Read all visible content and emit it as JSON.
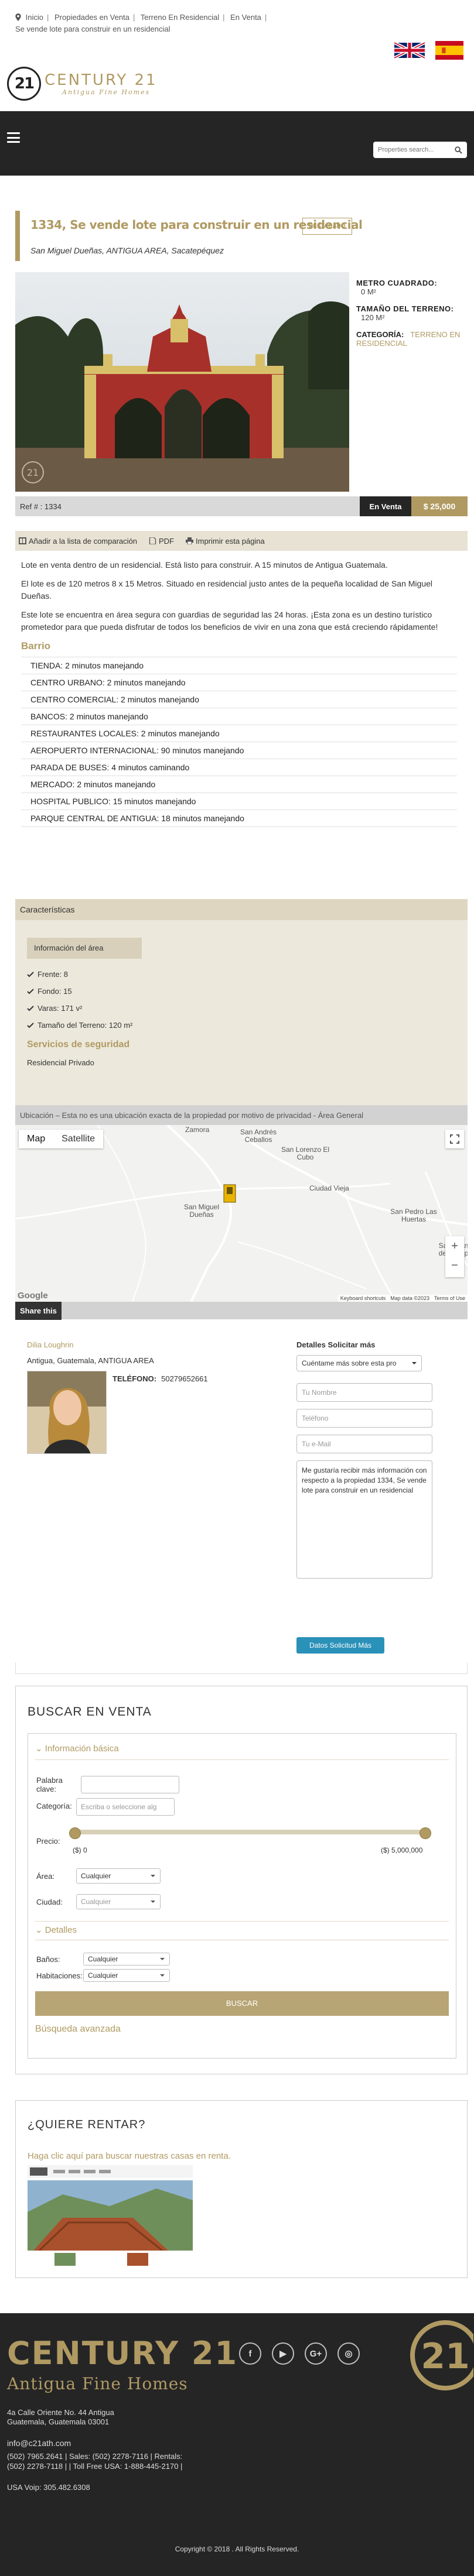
{
  "breadcrumbs": [
    "Inicio",
    "Propiedades en Venta",
    "Terreno En Residencial",
    "En Venta"
  ],
  "breadcrumb_current": "Se vende lote para construir en un residencial",
  "header": {
    "brand": "CENTURY 21",
    "brand_sub": "Antigua Fine Homes",
    "logo_mark": "21",
    "flags": [
      "uk-flag-icon",
      "spain-flag-icon"
    ]
  },
  "nav": {
    "search_placeholder": "Properties search..."
  },
  "listing": {
    "title": "1334,  Se vende lote para construir en un residencial",
    "badge": "DESTACADO",
    "location": "San Miguel Dueñas, ANTIGUA AREA, Sacatepéquez",
    "metro_label": "METRO CUADRADO:",
    "metro_value": "0 M²",
    "terreno_label": "TAMAÑO DEL TERRENO:",
    "terreno_value": "120 M²",
    "categoria_label": "CATEGORÍA:",
    "categoria_value": "TERRENO EN RESIDENCIAL",
    "ref": "Ref # : 1334",
    "status": "En Venta",
    "price": "$ 25,000"
  },
  "actions": {
    "compare": "Añadir a la lista de comparación",
    "pdf": "PDF",
    "print": "Imprimir esta página"
  },
  "description": [
    "Lote en venta dentro de un residencial. Está listo para construir. A 15 minutos de Antigua Guatemala.",
    "El lote es de 120 metros 8 x 15 Metros.  Situado en residencial justo antes de la pequeña localidad de San Miguel Dueñas.",
    "Este lote se encuentra en área segura con guardias de seguridad las 24 horas. ¡Esta zona es un destino turístico prometedor para que pueda disfrutar de todos los beneficios de vivir en una zona que está creciendo rápidamente!"
  ],
  "barrio": {
    "title": "Barrio",
    "items": [
      "TIENDA:   2 minutos manejando",
      "CENTRO URBANO:   2 minutos manejando",
      "CENTRO COMERCIAL:   2 minutos manejando",
      "BANCOS:   2 minutos manejando",
      "RESTAURANTES LOCALES:   2 minutos manejando",
      "AEROPUERTO INTERNACIONAL:   90 minutos manejando",
      "PARADA DE BUSES:   4 minutos caminando",
      "MERCADO:   2 minutos manejando",
      "HOSPITAL PUBLICO:   15 minutos manejando",
      "PARQUE CENTRAL DE ANTIGUA:   18 minutos manejando"
    ]
  },
  "caracteristicas": {
    "title": "Características",
    "tab": "Información del área",
    "items": [
      "Frente: 8",
      "Fondo: 15",
      "Varas: 171 v²",
      "Tamaño del Terreno: 120 m²"
    ],
    "servicios_title": "Servicios de seguridad",
    "servicios_item": "Residencial Privado"
  },
  "ubicacion": "Ubicación – Esta no es una ubicación exacta de la propiedad por motivo de privacidad - Área General",
  "map": {
    "tab_map": "Map",
    "tab_sat": "Satellite",
    "labels": [
      "Zamora",
      "San Andrés Ceballos",
      "San Lorenzo El Cubo",
      "Ciudad Vieja",
      "San Miguel Dueñas",
      "San Pedro Las Huertas",
      "San Juan del Obisp"
    ],
    "google": "Google",
    "footer": [
      "Keyboard shortcuts",
      "Map data ©2023",
      "Terms of Use"
    ]
  },
  "share_label": "Share this",
  "agent": {
    "name": "Dilia Loughrin",
    "location": "Antigua, Guatemala, ANTIGUA AREA",
    "tel_label": "TELÉFONO:",
    "tel": "50279652661"
  },
  "contact": {
    "title": "Detalles Solicitar más",
    "select": "Cuéntame más sobre esta pro",
    "name_ph": "Tu Nombre",
    "phone_ph": "Teléfono",
    "email_ph": "Tu e-Mail",
    "message": "Me gustaría recibir más información con respecto a la propiedad 1334, Se vende lote para construir en un residencial",
    "button": "Datos Solicitud Más"
  },
  "buscar": {
    "title": "BUSCAR EN VENTA",
    "info_basica": "Información básica",
    "palabra_label": "Palabra clave:",
    "categoria_label": "Categoría:",
    "categoria_ph": "Escriba o seleccione alg",
    "precio_label": "Precio:",
    "precio_min": "($) 0",
    "precio_max": "($) 5,000,000",
    "area_label": "Área:",
    "area_value": "Cualquier",
    "ciudad_label": "Ciudad:",
    "ciudad_value": "Cualquier",
    "detalles": "Detalles",
    "banos_label": "Baños:",
    "banos_value": "Cualquier",
    "habitaciones_label": "Habitaciones:",
    "habitaciones_value": "Cualquier",
    "button": "BUSCAR",
    "avanzada": "Búsqueda avanzada"
  },
  "rentar": {
    "title": "¿QUIERE RENTAR?",
    "link": "Haga clic aquí para buscar nuestras casas en renta."
  },
  "footer": {
    "brand": "CENTURY 21",
    "sub": "Antigua Fine Homes",
    "logo_mark": "21",
    "socials": [
      "f",
      "▶",
      "G+",
      "◎"
    ],
    "address1": "4a Calle Oriente No. 44 Antigua",
    "address2": "Guatemala, Guatemala 03001",
    "email": "info@c21ath.com",
    "phone1": "(502) 7965.2641 | Sales: (502) 2278-7116 | Rentals:",
    "phone2": "(502) 2278-7118 | | Toll Free USA: 1-888-445-2170 |",
    "usa": "USA Voip: 305.482.6308",
    "copyright": "Copyright © 2018  . All Rights Reserved."
  },
  "colors": {
    "gold": "#b09a62",
    "dark": "#252526",
    "blue_button": "#2a91b8"
  }
}
